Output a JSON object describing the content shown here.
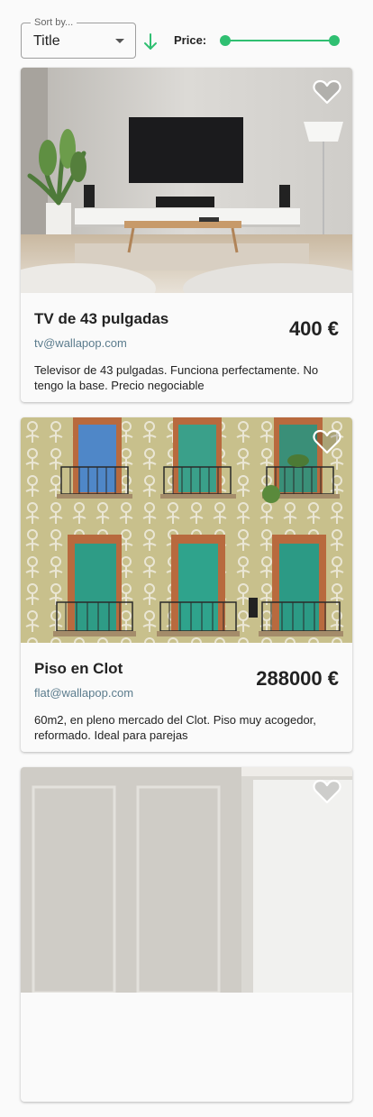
{
  "toolbar": {
    "sort_label": "Sort by...",
    "sort_value": "Title",
    "sort_direction_icon": "arrow-down-icon",
    "price_label": "Price:",
    "accent_color": "#2fbf71"
  },
  "products": [
    {
      "title": "TV de 43 pulgadas",
      "email": "tv@wallapop.com",
      "price": "400 €",
      "description": "Televisor de 43 pulgadas. Funciona perfectamente. No tengo la base. Precio negociable",
      "image": "living-room-tv-photo",
      "favorite_icon": "heart-outline-icon"
    },
    {
      "title": "Piso en Clot",
      "email": "flat@wallapop.com",
      "price": "288000 €",
      "description": "60m2, en pleno mercado del Clot. Piso muy acogedor, reformado. Ideal para parejas",
      "image": "building-facade-photo",
      "favorite_icon": "heart-outline-icon"
    },
    {
      "title": "",
      "email": "",
      "price": "",
      "description": "",
      "image": "interior-room-photo",
      "favorite_icon": "heart-outline-icon"
    }
  ]
}
